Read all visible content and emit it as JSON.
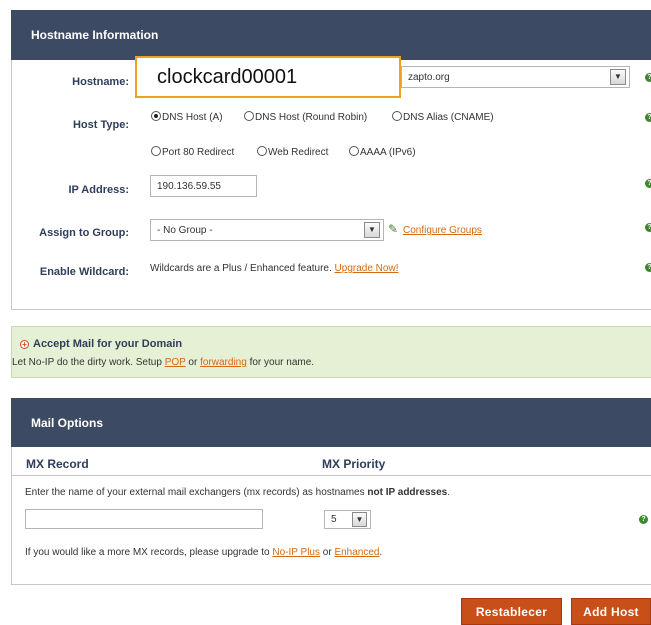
{
  "hostname_panel": {
    "title": "Hostname Information",
    "hostname": {
      "label": "Hostname:",
      "value": "clockcard00001",
      "domain": "zapto.org"
    },
    "host_type": {
      "label": "Host Type:",
      "options": [
        {
          "label": "DNS Host (A)",
          "selected": true
        },
        {
          "label": "DNS Host (Round Robin)",
          "selected": false
        },
        {
          "label": "DNS Alias (CNAME)",
          "selected": false
        },
        {
          "label": "Port 80 Redirect",
          "selected": false
        },
        {
          "label": "Web Redirect",
          "selected": false
        },
        {
          "label": "AAAA (IPv6)",
          "selected": false
        }
      ]
    },
    "ip_address": {
      "label": "IP Address:",
      "value": "190.136.59.55"
    },
    "assign_group": {
      "label": "Assign to Group:",
      "value": "- No Group -",
      "configure_link": "Configure Groups"
    },
    "wildcard": {
      "label": "Enable Wildcard:",
      "text": "Wildcards are a Plus / Enhanced feature.",
      "link": "Upgrade Now!"
    }
  },
  "accept_mail": {
    "title": "Accept Mail for your Domain",
    "text_before": "Let No-IP do the dirty work. Setup",
    "pop_link": "POP",
    "or": "or",
    "forwarding_link": "forwarding",
    "text_after": "for your name."
  },
  "mail_options": {
    "title": "Mail Options",
    "col_mx_record": "MX Record",
    "col_mx_priority": "MX Priority",
    "instruction_before": "Enter the name of your external mail exchangers (mx records) as hostnames",
    "instruction_bold": "not IP addresses",
    "instruction_after": ".",
    "mx_value": "",
    "priority_value": "5",
    "upgrade_before": "If you would like a more MX records, please upgrade to",
    "plus_link": "No-IP Plus",
    "or": "or",
    "enhanced_link": "Enhanced",
    "upgrade_after": "."
  },
  "buttons": {
    "reset": "Restablecer",
    "add_host": "Add Host"
  },
  "colors": {
    "header_bg": "#3d4a63",
    "accent_orange": "#d46a12",
    "button_bg": "#c94f18",
    "mail_banner_bg": "#e6f0d4"
  }
}
